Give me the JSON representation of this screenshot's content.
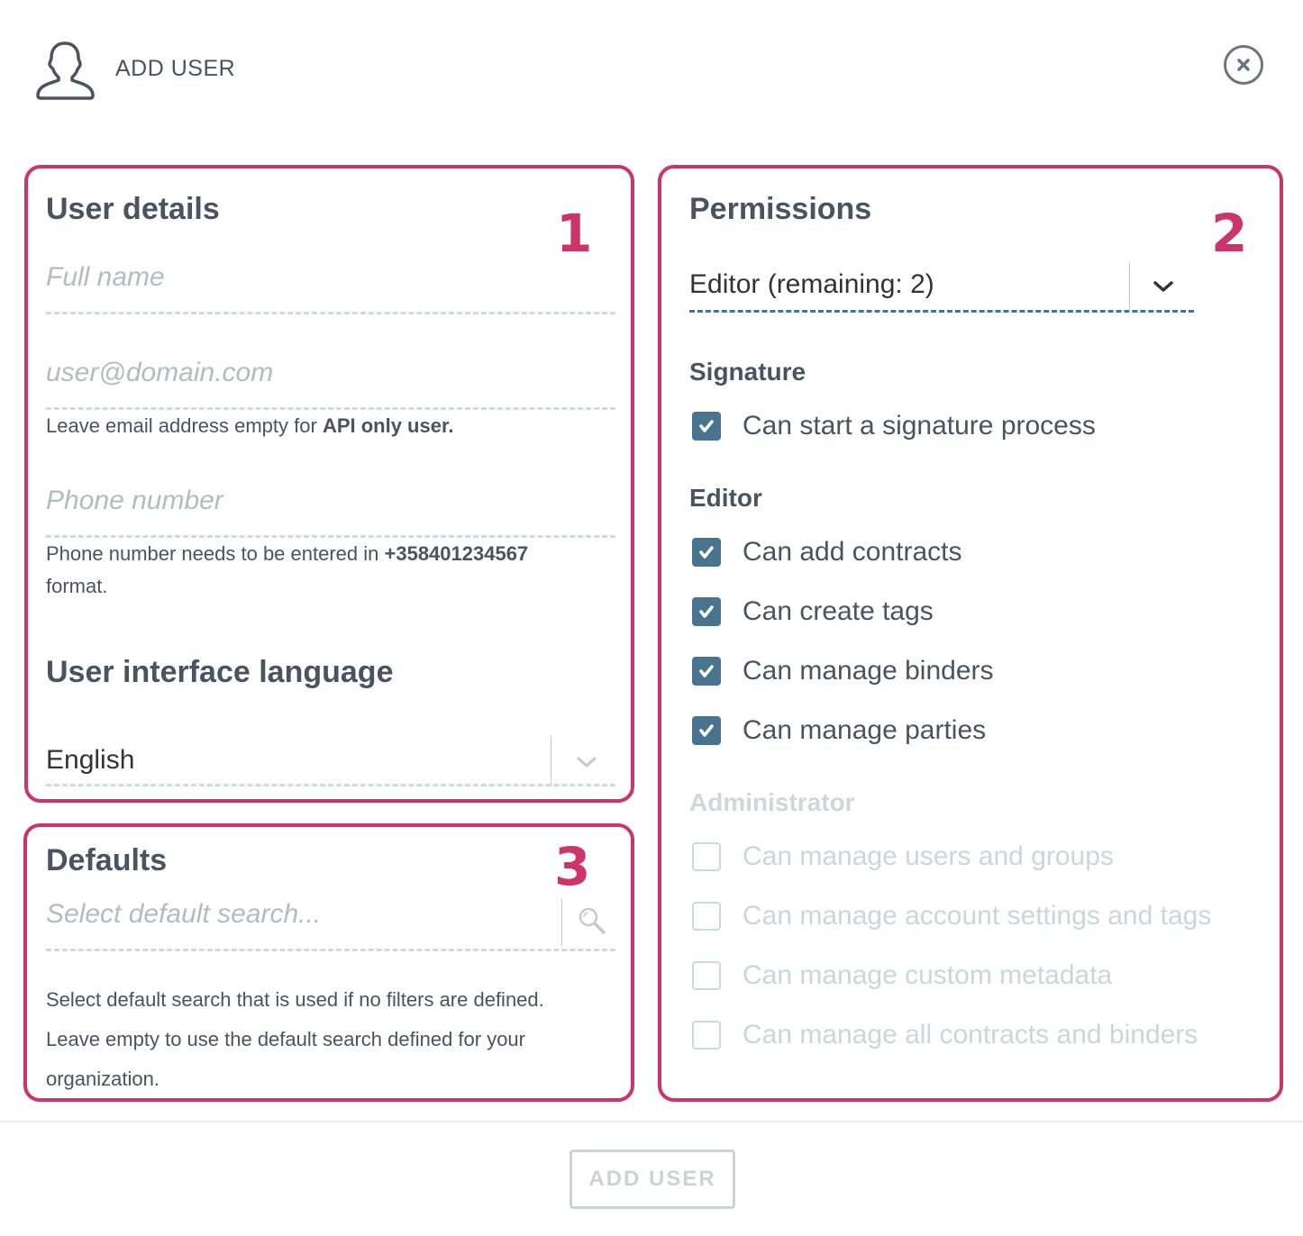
{
  "header": {
    "title": "ADD USER",
    "icon": "user-icon",
    "close_icon": "close-icon"
  },
  "user_details": {
    "badge": "1",
    "title": "User details",
    "full_name": {
      "value": "",
      "placeholder": "Full name"
    },
    "email": {
      "value": "",
      "placeholder": "user@domain.com"
    },
    "email_help_prefix": "Leave email address empty for ",
    "email_help_bold": "API only user.",
    "phone": {
      "value": "",
      "placeholder": "Phone number"
    },
    "phone_help_prefix": "Phone number needs to be entered in ",
    "phone_help_bold": "+358401234567",
    "phone_help_suffix": "format.",
    "language_title": "User interface language",
    "language_value": "English"
  },
  "permissions": {
    "badge": "2",
    "title": "Permissions",
    "role_value": "Editor (remaining: 2)",
    "groups": [
      {
        "title": "Signature",
        "disabled": false,
        "items": [
          {
            "label": "Can start a signature process",
            "checked": true
          }
        ]
      },
      {
        "title": "Editor",
        "disabled": false,
        "items": [
          {
            "label": "Can add contracts",
            "checked": true
          },
          {
            "label": "Can create tags",
            "checked": true
          },
          {
            "label": "Can manage binders",
            "checked": true
          },
          {
            "label": "Can manage parties",
            "checked": true
          }
        ]
      },
      {
        "title": "Administrator",
        "disabled": true,
        "items": [
          {
            "label": "Can manage users and groups",
            "checked": false
          },
          {
            "label": "Can manage account settings and tags",
            "checked": false
          },
          {
            "label": "Can manage custom metadata",
            "checked": false
          },
          {
            "label": "Can manage all contracts and binders",
            "checked": false
          }
        ]
      }
    ]
  },
  "defaults": {
    "badge": "3",
    "title": "Defaults",
    "search": {
      "value": "",
      "placeholder": "Select default search..."
    },
    "help_line1": "Select default search that is used if no filters are defined.",
    "help_line2": "Leave empty to use the default search defined for your",
    "help_line3": "organization."
  },
  "footer": {
    "add_button_label": "ADD USER"
  },
  "colors": {
    "accent": "#cc346a",
    "checkbox": "#48748f",
    "text": "#4a5361",
    "disabled": "#cdd5db"
  }
}
